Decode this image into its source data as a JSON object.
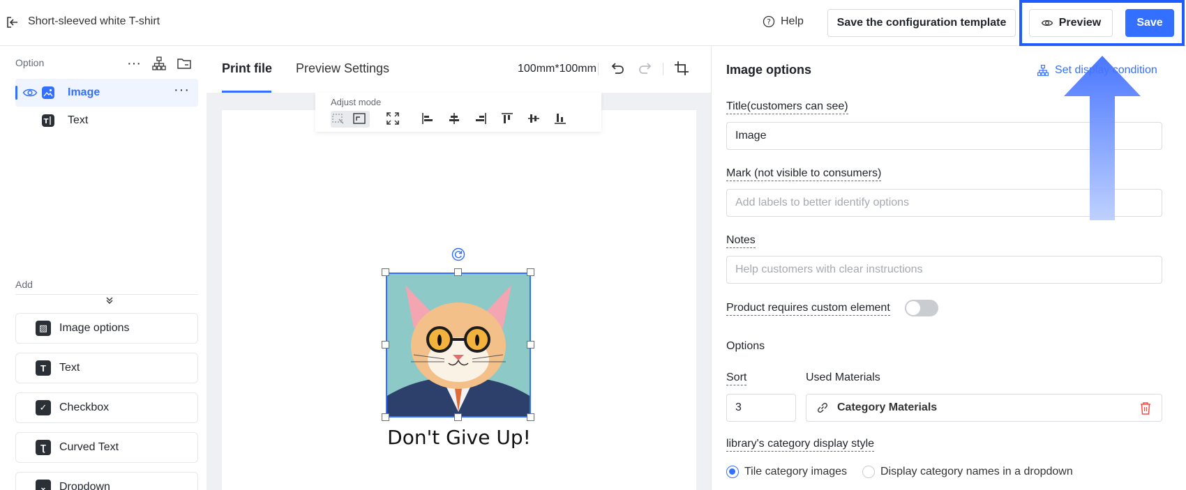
{
  "header": {
    "title": "Short-sleeved white T-shirt",
    "help": "Help",
    "save_template": "Save the configuration template",
    "preview": "Preview",
    "save": "Save"
  },
  "sidebar": {
    "option_label": "Option",
    "layers": [
      {
        "label": "Image",
        "icon": "image-icon",
        "active": true
      },
      {
        "label": "Text",
        "icon": "text-icon",
        "active": false
      }
    ],
    "add_label": "Add",
    "add_items": [
      {
        "label": "Image options",
        "icon": "image-options-icon"
      },
      {
        "label": "Text",
        "icon": "text-icon"
      },
      {
        "label": "Checkbox",
        "icon": "checkbox-icon"
      },
      {
        "label": "Curved Text",
        "icon": "curved-text-icon"
      },
      {
        "label": "Dropdown",
        "icon": "dropdown-icon"
      }
    ]
  },
  "canvas": {
    "tabs": [
      "Print file",
      "Preview Settings"
    ],
    "active_tab": "Print file",
    "size": "100mm*100mm",
    "adjust_mode": "Adjust mode",
    "caption": "Don't Give Up!"
  },
  "panel": {
    "title": "Image options",
    "condition_link": "Set display condition",
    "title_label": "Title(customers can see)",
    "title_value": "Image",
    "mark_label": "Mark (not visible to consumers)",
    "mark_placeholder": "Add labels to better identify options",
    "notes_label": "Notes",
    "notes_placeholder": "Help customers with clear instructions",
    "custom_element_label": "Product requires custom element",
    "custom_element_on": false,
    "options_label": "Options",
    "sort_label": "Sort",
    "sort_value": "3",
    "used_materials_label": "Used Materials",
    "material_value": "Category Materials",
    "display_style_label": "library's category display style",
    "display_options": [
      "Tile category images",
      "Display category names in a dropdown"
    ],
    "display_selected": "Tile category images"
  },
  "colors": {
    "accent": "#3370ff",
    "highlight": "#1f5cff",
    "delete": "#f54a45"
  }
}
